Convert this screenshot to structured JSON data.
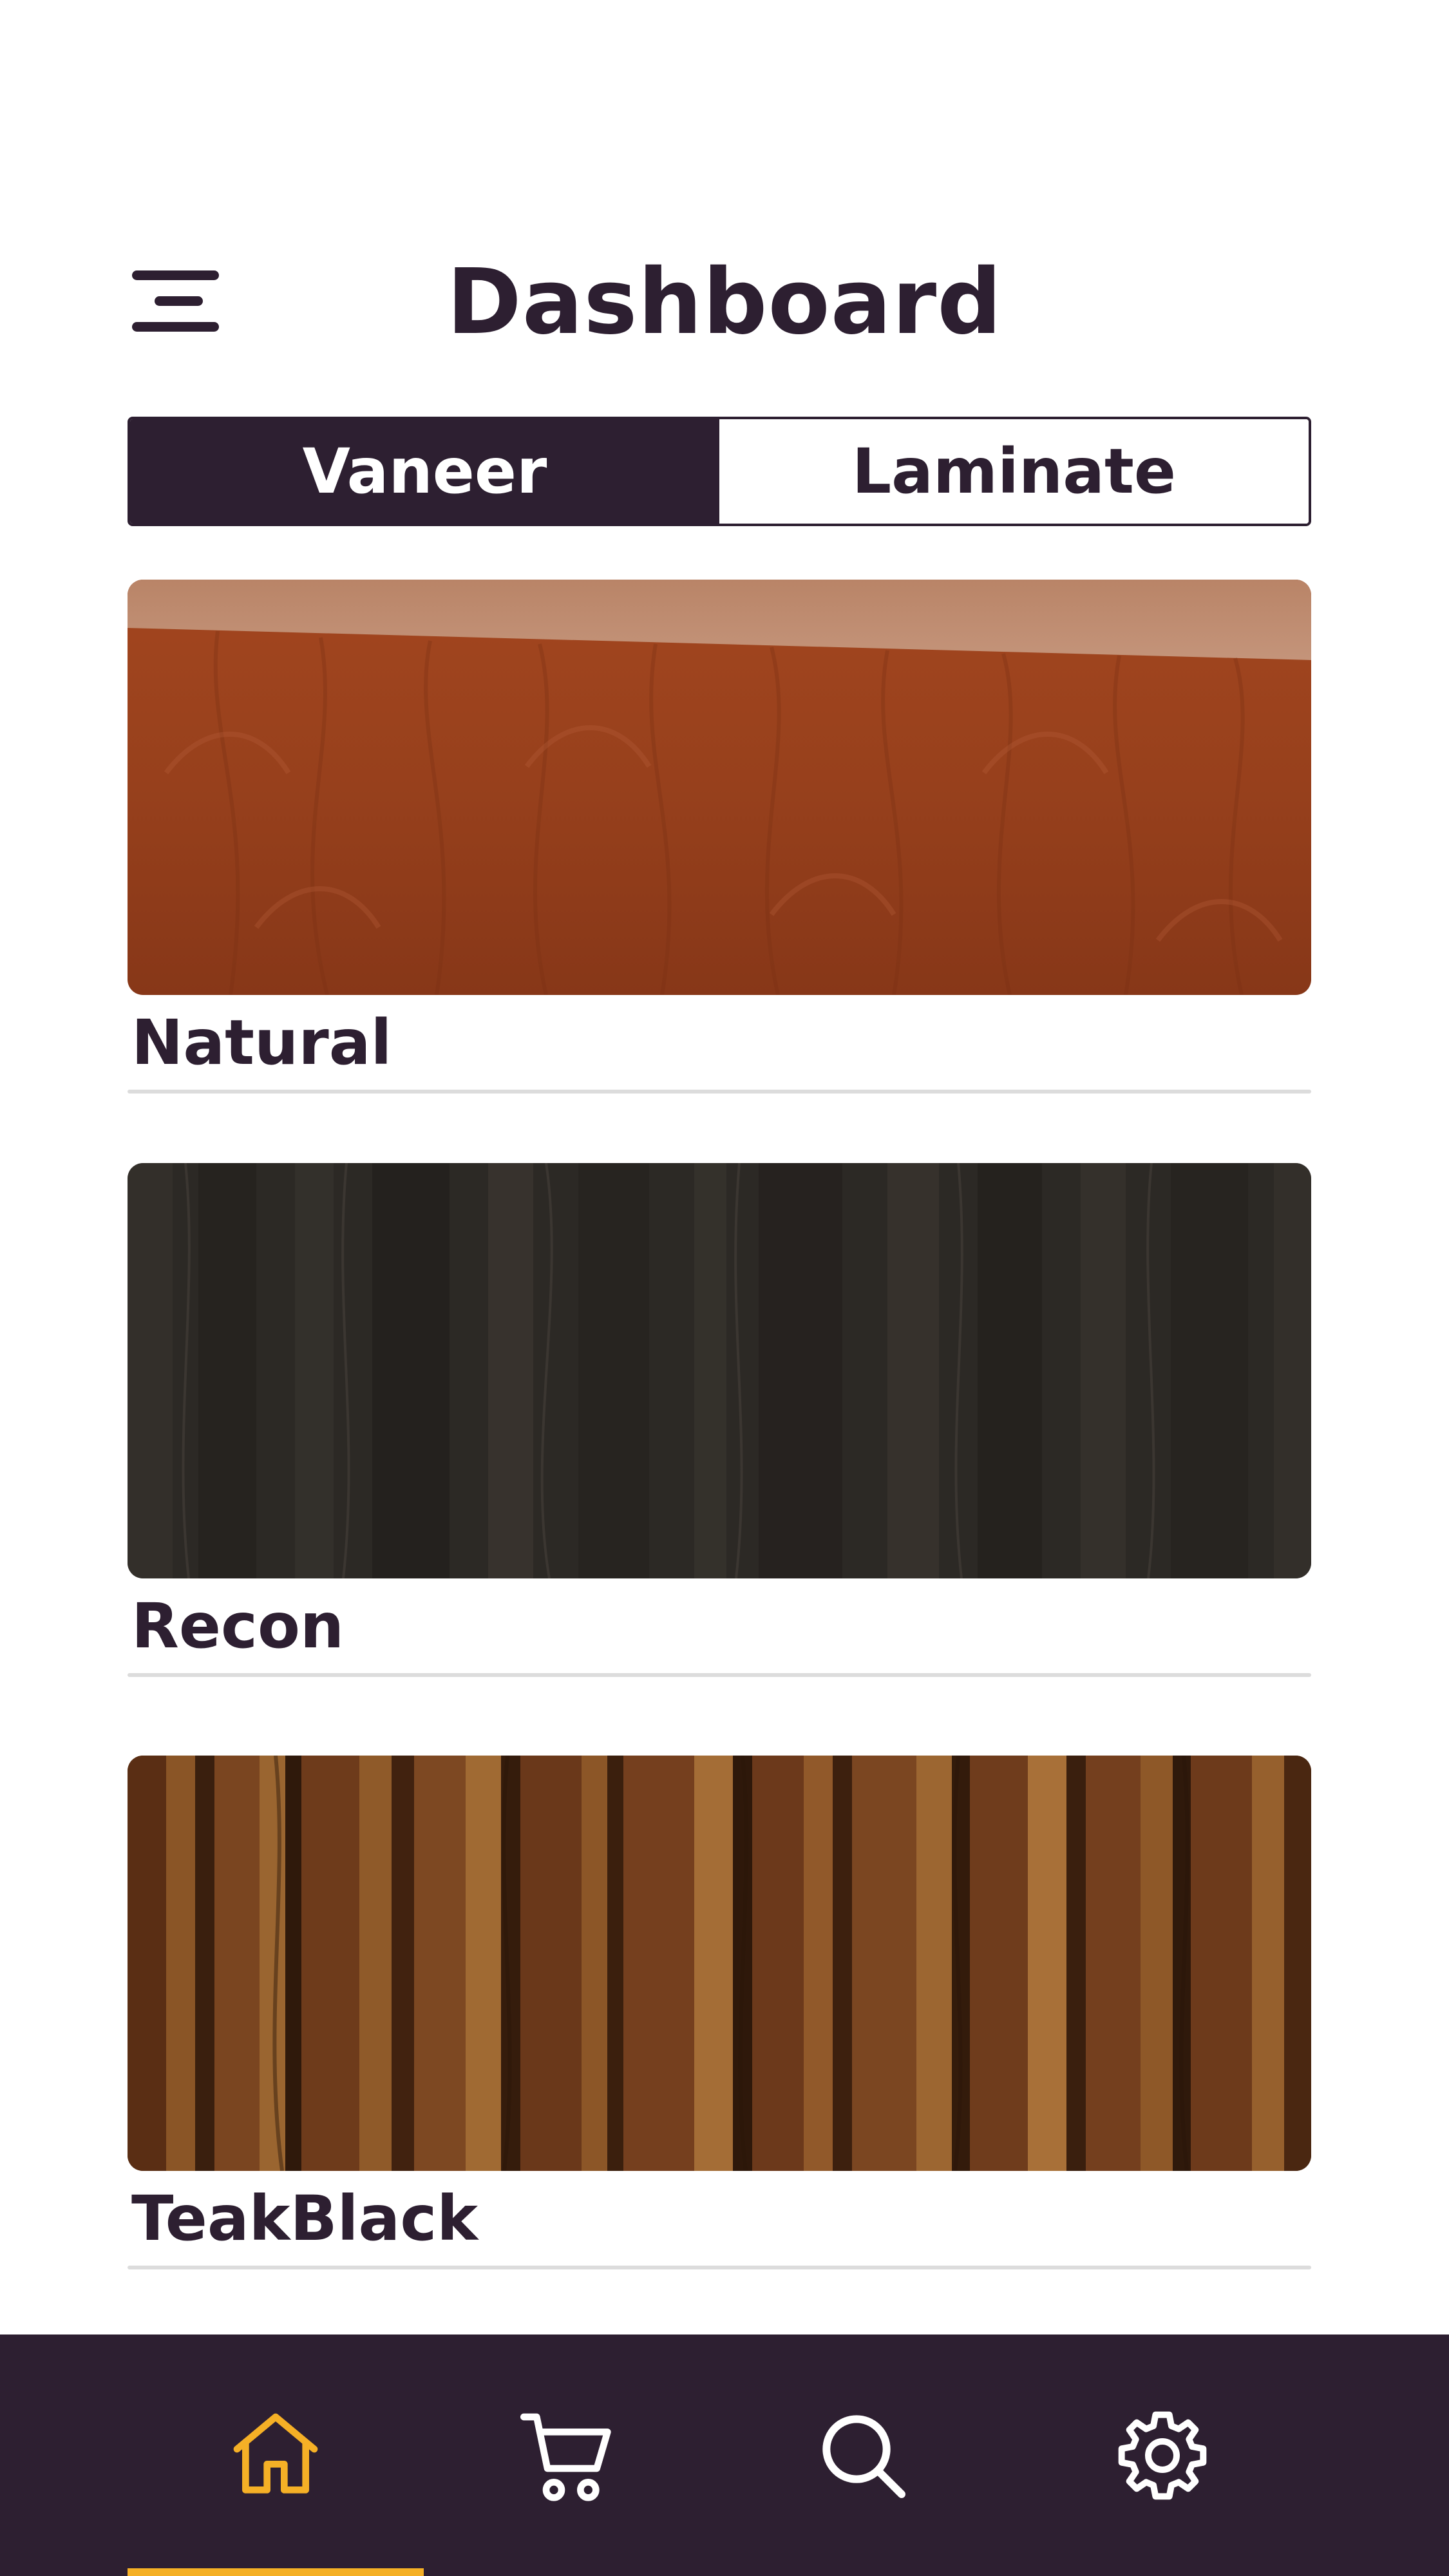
{
  "header": {
    "title": "Dashboard",
    "menu_icon": "hamburger-menu-icon"
  },
  "segments": {
    "items": [
      {
        "label": "Vaneer",
        "active": true
      },
      {
        "label": "Laminate",
        "active": false
      }
    ]
  },
  "cards": [
    {
      "label": "Natural",
      "texture": "natural-light-brown-veneer"
    },
    {
      "label": "Recon",
      "texture": "dark-grey-wood-grain"
    },
    {
      "label": "TeakBlack",
      "texture": "teak-striped-brown"
    }
  ],
  "bottom_nav": {
    "items": [
      {
        "icon": "home-icon",
        "active": true
      },
      {
        "icon": "cart-icon",
        "active": false
      },
      {
        "icon": "search-icon",
        "active": false
      },
      {
        "icon": "settings-gear-icon",
        "active": false
      }
    ]
  },
  "colors": {
    "primary": "#2d1f31",
    "accent": "#f5b026",
    "background": "#ffffff",
    "divider": "#dcdcdc"
  }
}
